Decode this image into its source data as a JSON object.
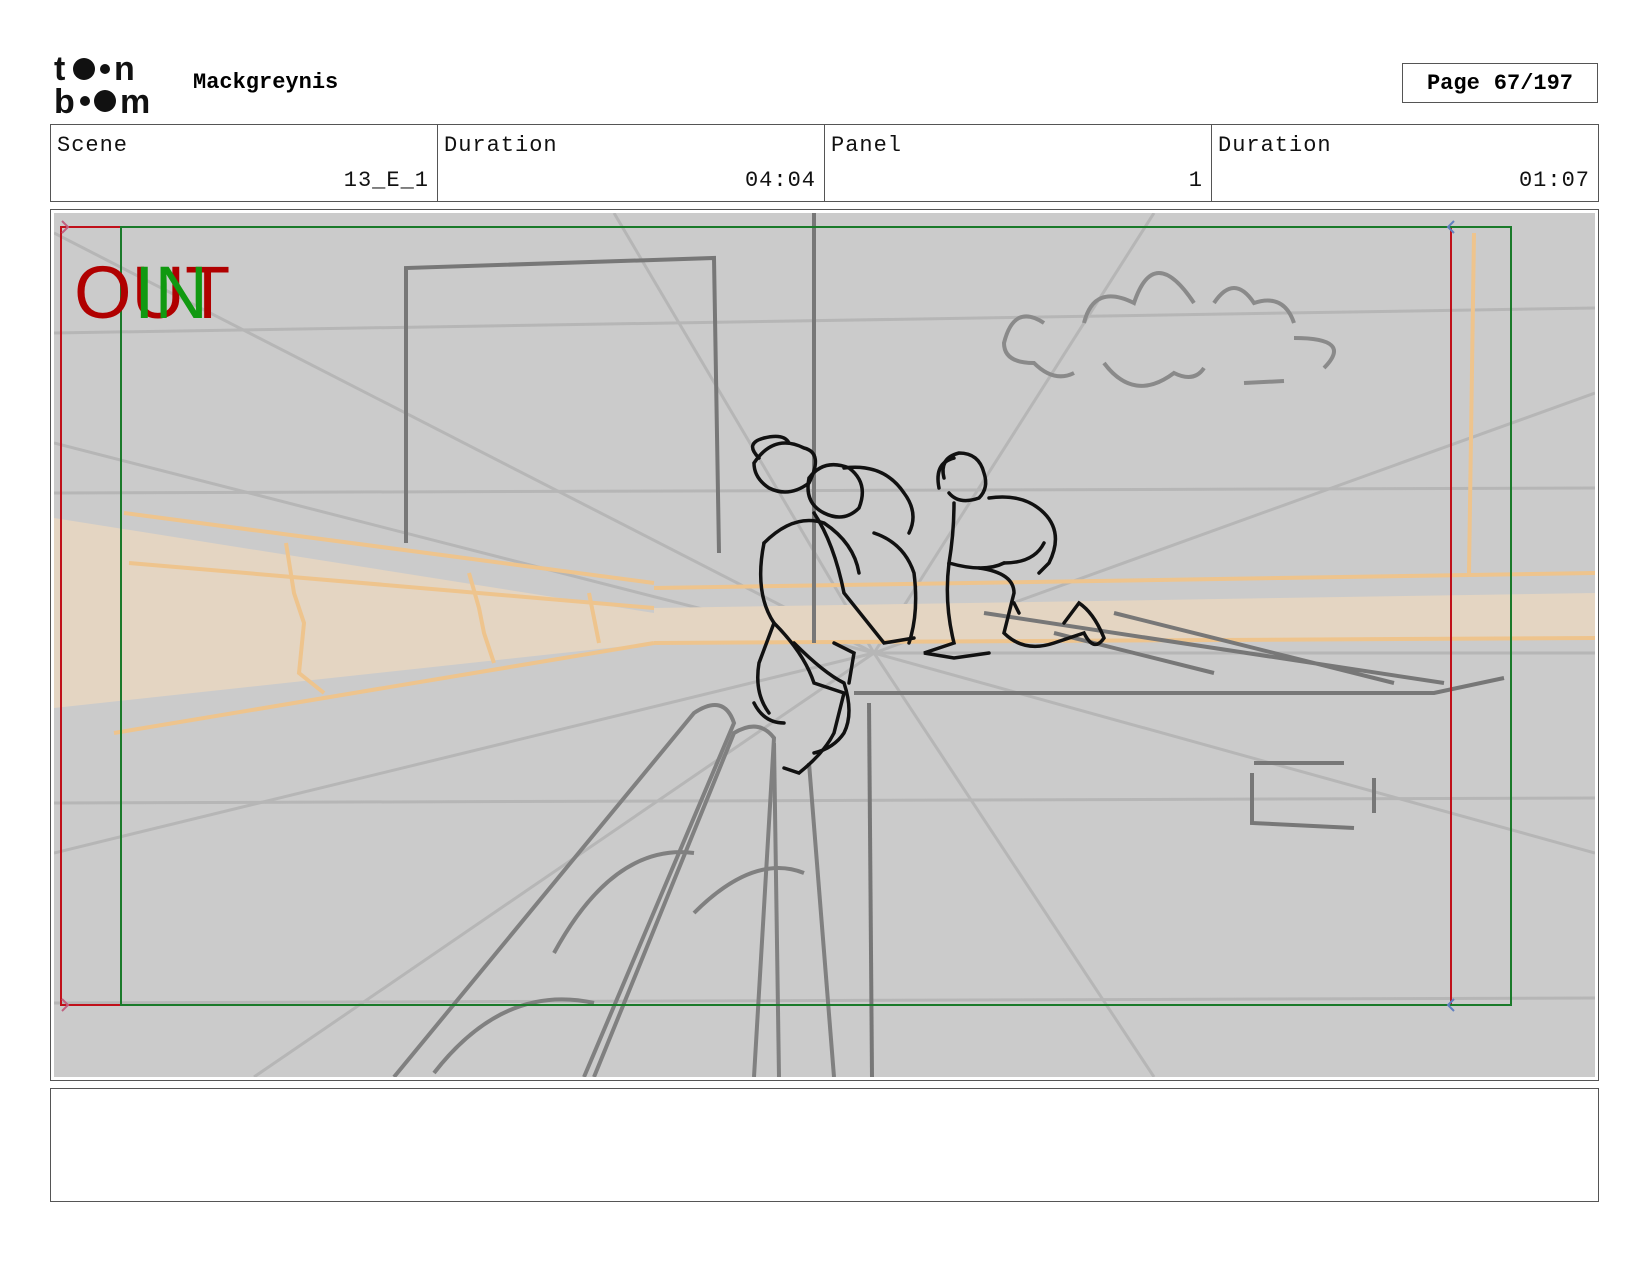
{
  "header": {
    "logo_text": "toonboom",
    "project_name": "Mackgreynis",
    "page_label": "Page",
    "page_value": "67/197"
  },
  "info": {
    "scene_label": "Scene",
    "scene_value": "13_E_1",
    "scene_duration_label": "Duration",
    "scene_duration_value": "04:04",
    "panel_label": "Panel",
    "panel_value": "1",
    "panel_duration_label": "Duration",
    "panel_duration_value": "01:07"
  },
  "artwork": {
    "out_marker": "OUT",
    "in_marker": "IN",
    "out_color": "#b00000",
    "in_color": "#119911"
  },
  "notes": {
    "text": ""
  }
}
